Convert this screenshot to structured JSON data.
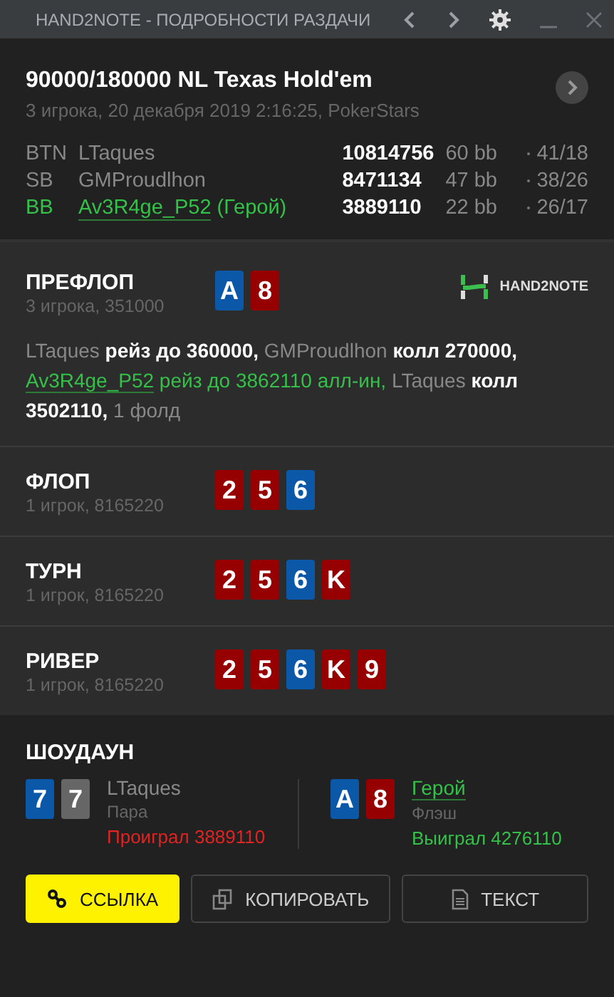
{
  "window": {
    "title": "HAND2NOTE - ПОДРОБНОСТИ РАЗДАЧИ"
  },
  "header": {
    "title": "90000/180000 NL Texas Hold'em",
    "subtitle": "3 игрока, 20 декабря 2019 2:16:25, PokerStars"
  },
  "players": [
    {
      "position": "BTN",
      "name": "LTaques",
      "hero": false,
      "stack": "10814756",
      "bb": "60 bb",
      "stats": "41/18"
    },
    {
      "position": "SB",
      "name": "GMProudlhon",
      "hero": false,
      "stack": "8471134",
      "bb": "47 bb",
      "stats": "38/26"
    },
    {
      "position": "BB",
      "name": "Av3R4ge_P52",
      "hero": true,
      "hero_label": "(Герой)",
      "stack": "3889110",
      "bb": "22 bb",
      "stats": "26/17"
    }
  ],
  "streets": [
    {
      "name": "ПРЕФЛОП",
      "info": "3 игрока, 351000",
      "cards": [
        {
          "rank": "A",
          "color": "#0b57a8"
        },
        {
          "rank": "8",
          "color": "#960000"
        }
      ],
      "logo": "HAND2NOTE",
      "actions": [
        {
          "kind": "player",
          "text": "LTaques"
        },
        {
          "kind": "action",
          "text": " рейз до 360000, "
        },
        {
          "kind": "player",
          "text": "GMProudlhon"
        },
        {
          "kind": "action",
          "text": " колл 270000, "
        },
        {
          "kind": "hero",
          "text": "Av3R4ge_P52"
        },
        {
          "kind": "hero_action",
          "text": " рейз до 3862110 алл-ин, "
        },
        {
          "kind": "player",
          "text": "LTaques"
        },
        {
          "kind": "action",
          "text": " колл 3502110, "
        },
        {
          "kind": "player",
          "text": "1 фолд"
        }
      ]
    },
    {
      "name": "ФЛОП",
      "info": "1 игрок, 8165220",
      "cards": [
        {
          "rank": "2",
          "color": "#960000"
        },
        {
          "rank": "5",
          "color": "#960000"
        },
        {
          "rank": "6",
          "color": "#0b57a8"
        }
      ]
    },
    {
      "name": "ТУРН",
      "info": "1 игрок, 8165220",
      "cards": [
        {
          "rank": "2",
          "color": "#960000"
        },
        {
          "rank": "5",
          "color": "#960000"
        },
        {
          "rank": "6",
          "color": "#0b57a8"
        },
        {
          "rank": "K",
          "color": "#960000"
        }
      ]
    },
    {
      "name": "РИВЕР",
      "info": "1 игрок, 8165220",
      "cards": [
        {
          "rank": "2",
          "color": "#960000"
        },
        {
          "rank": "5",
          "color": "#960000"
        },
        {
          "rank": "6",
          "color": "#0b57a8"
        },
        {
          "rank": "K",
          "color": "#960000"
        },
        {
          "rank": "9",
          "color": "#960000"
        }
      ]
    }
  ],
  "showdown": {
    "title": "ШОУДАУН",
    "hands": [
      {
        "name": "LTaques",
        "hero": false,
        "combo": "Пара",
        "result": "Проиграл 3889110",
        "won": false,
        "cards": [
          {
            "rank": "7",
            "color": "#0b57a8"
          },
          {
            "rank": "7",
            "color": "#666666"
          }
        ]
      },
      {
        "name": "Герой",
        "hero": true,
        "combo": "Флэш",
        "result": "Выиграл 4276110",
        "won": true,
        "cards": [
          {
            "rank": "A",
            "color": "#0b57a8"
          },
          {
            "rank": "8",
            "color": "#960000"
          }
        ]
      }
    ]
  },
  "buttons": [
    {
      "kind": "link",
      "label": "ССЫЛКА",
      "primary": true
    },
    {
      "kind": "copy",
      "label": "КОПИРОВАТЬ",
      "primary": false
    },
    {
      "kind": "text",
      "label": "ТЕКСТ",
      "primary": false
    }
  ]
}
